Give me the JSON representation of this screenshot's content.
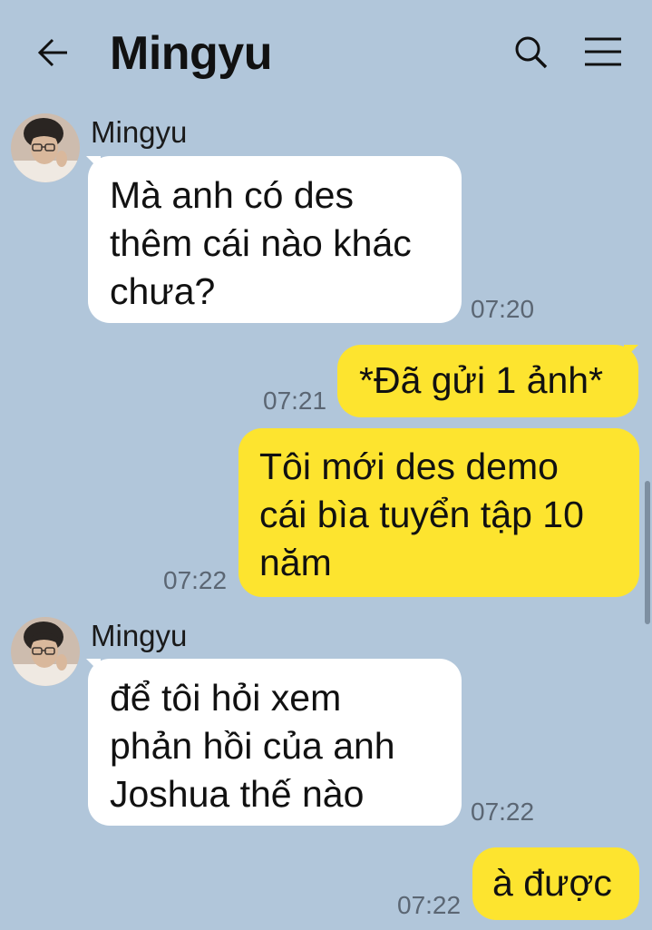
{
  "header": {
    "title": "Mingyu",
    "back_icon": "arrow-left-icon",
    "search_icon": "search-icon",
    "menu_icon": "hamburger-menu-icon"
  },
  "colors": {
    "background": "#b1c6da",
    "incoming_bubble": "#ffffff",
    "outgoing_bubble": "#fde42f",
    "timestamp": "#5b6673"
  },
  "messages": [
    {
      "direction": "in",
      "sender": "Mingyu",
      "text": "Mà anh có des\nthêm cái nào khác\nchưa?",
      "time": "07:20"
    },
    {
      "direction": "out",
      "text": "*Đã gửi 1 ảnh*",
      "time": "07:21"
    },
    {
      "direction": "out",
      "text": "Tôi mới des demo\ncái bìa tuyển tập 10\nnăm",
      "time": "07:22"
    },
    {
      "direction": "in",
      "sender": "Mingyu",
      "text": "để tôi hỏi xem\nphản hồi của anh\nJoshua thế nào",
      "time": "07:22"
    },
    {
      "direction": "out",
      "text": "à được",
      "time": "07:22"
    }
  ]
}
